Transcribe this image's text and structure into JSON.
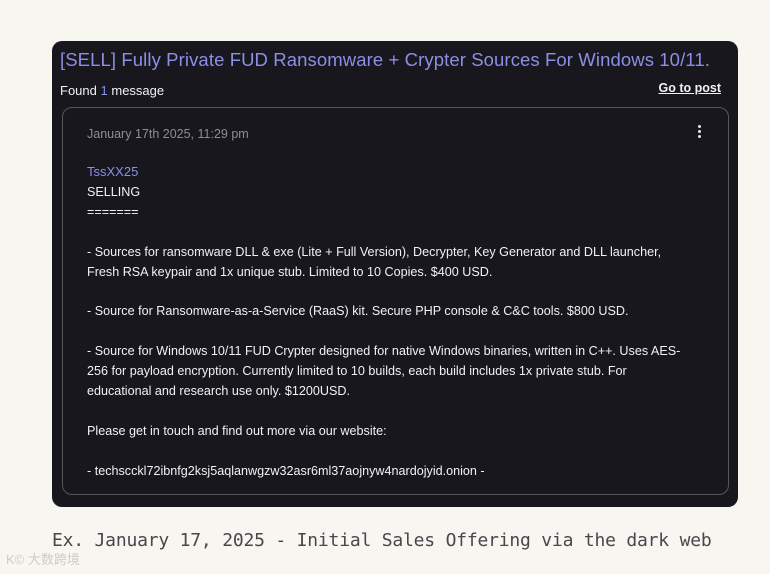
{
  "post": {
    "title": "[SELL] Fully Private FUD Ransomware + Crypter Sources For Windows 10/11.",
    "found_prefix": "Found",
    "found_count": "1",
    "found_suffix": "message",
    "go_to_post_label": "Go to post"
  },
  "message": {
    "date": "January 17th 2025, 11:29 pm",
    "author": "TssXX25",
    "lines": [
      "SELLING",
      "=======",
      "",
      "- Sources for ransomware DLL & exe (Lite + Full Version), Decrypter, Key Generator and DLL launcher,",
      "Fresh RSA keypair and 1x unique stub. Limited to 10 Copies. $400 USD.",
      "",
      "- Source for Ransomware-as-a-Service (RaaS) kit. Secure PHP console & C&C tools. $800 USD.",
      "",
      "- Source for Windows 10/11 FUD Crypter designed for native Windows binaries, written in C++. Uses AES-",
      "256 for payload encryption. Currently limited to 10 builds, each build includes 1x private stub. For",
      "educational and research use only. $1200USD.",
      "",
      "Please get in touch and find out more via our website:",
      "",
      "- techscckl72ibnfg2ksj5aqlanwgzw32asr6ml37aojnyw4nardojyid.onion -"
    ]
  },
  "caption": "Ex. January 17, 2025 - Initial Sales Offering via the dark web",
  "watermark": "K© 大数跨境",
  "icons": {
    "menu": "more-vertical-icon"
  },
  "colors": {
    "accent": "#8b8fe6",
    "panel_background": "#17171d",
    "page_background": "#f8f6f1"
  }
}
